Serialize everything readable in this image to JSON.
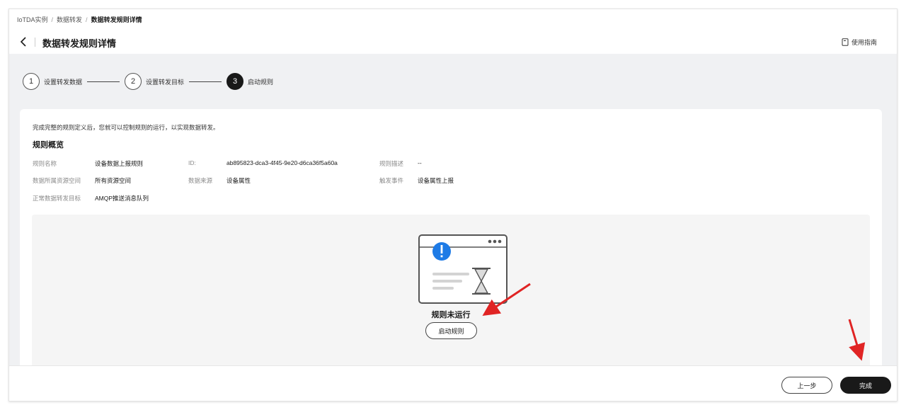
{
  "breadcrumb": {
    "items": [
      "IoTDA实例",
      "数据转发",
      "数据转发规则详情"
    ]
  },
  "header": {
    "title": "数据转发规则详情",
    "guide_label": "使用指南",
    "back_icon": "chevron-left-icon",
    "guide_icon": "document-icon"
  },
  "steps": [
    {
      "number": "1",
      "label": "设置转发数据",
      "active": false
    },
    {
      "number": "2",
      "label": "设置转发目标",
      "active": false
    },
    {
      "number": "3",
      "label": "启动规则",
      "active": true
    }
  ],
  "card": {
    "intro": "完成完整的规则定义后，您就可以控制规则的运行，以实现数据转发。",
    "section_title": "规则概览",
    "fields": {
      "rule_name": {
        "label": "规则名称",
        "value": "设备数据上报规则"
      },
      "id": {
        "label": "ID:",
        "value": "ab895823-dca3-4f45-9e20-d6ca36f5a60a"
      },
      "description": {
        "label": "规则描述",
        "value": "--"
      },
      "resource_space": {
        "label": "数据所属资源空间",
        "value": "所有资源空间"
      },
      "data_source": {
        "label": "数据来源",
        "value": "设备属性"
      },
      "trigger_event": {
        "label": "触发事件",
        "value": "设备属性上报"
      },
      "target": {
        "label": "正常数据转发目标",
        "value": "AMQP推送消息队列"
      }
    }
  },
  "empty_state": {
    "status": "规则未运行",
    "start_button": "启动规则",
    "illustration_icon": "rule-paused-illustration-icon"
  },
  "footer": {
    "prev_label": "上一步",
    "done_label": "完成"
  },
  "colors": {
    "primary": "#191919",
    "info_blue": "#1e7be6",
    "annotation_red": "#e02424",
    "background": "#f0f1f3"
  }
}
